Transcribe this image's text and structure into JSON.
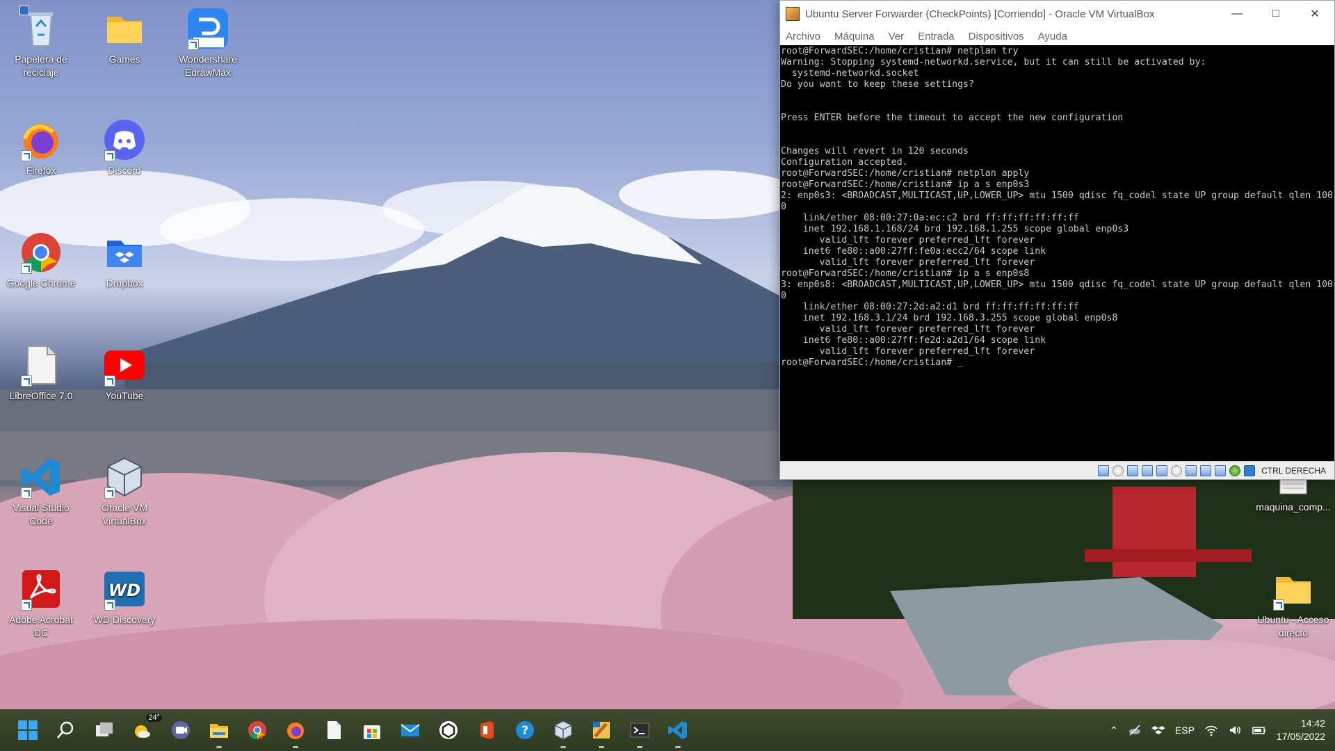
{
  "desktop": {
    "icons": [
      {
        "label": "Papelera de reciclaje",
        "icon": "recycle-bin-icon"
      },
      {
        "label": "Games",
        "icon": "folder-icon"
      },
      {
        "label": "Wondershare EdrawMax",
        "icon": "edrawmax-icon"
      },
      {
        "label": "Firefox",
        "icon": "firefox-icon"
      },
      {
        "label": "Discord",
        "icon": "discord-icon"
      },
      {
        "label": "Google Chrome",
        "icon": "chrome-icon"
      },
      {
        "label": "Dropbox",
        "icon": "dropbox-icon"
      },
      {
        "label": "LibreOffice 7.0",
        "icon": "libreoffice-icon"
      },
      {
        "label": "YouTube",
        "icon": "youtube-icon"
      },
      {
        "label": "Visual Studio Code",
        "icon": "vscode-icon"
      },
      {
        "label": "Oracle VM VirtualBox",
        "icon": "virtualbox-icon"
      },
      {
        "label": "Adobe Acrobat DC",
        "icon": "acrobat-icon"
      },
      {
        "label": "WD Discovery",
        "icon": "wd-discovery-icon"
      },
      {
        "label": "maquina_comp...",
        "icon": "document-icon"
      },
      {
        "label": "Ubuntu - Acceso directo",
        "icon": "folder-icon"
      }
    ]
  },
  "vbox": {
    "title": "Ubuntu Server Forwarder (CheckPoints) [Corriendo] - Oracle VM VirtualBox",
    "menu": [
      "Archivo",
      "Máquina",
      "Ver",
      "Entrada",
      "Dispositivos",
      "Ayuda"
    ],
    "host_key": "CTRL DERECHA",
    "terminal_lines": [
      "root@ForwardSEC:/home/cristian# netplan try",
      "Warning: Stopping systemd-networkd.service, but it can still be activated by:",
      "  systemd-networkd.socket",
      "Do you want to keep these settings?",
      "",
      "",
      "Press ENTER before the timeout to accept the new configuration",
      "",
      "",
      "Changes will revert in 120 seconds",
      "Configuration accepted.",
      "root@ForwardSEC:/home/cristian# netplan apply",
      "root@ForwardSEC:/home/cristian# ip a s enp0s3",
      "2: enp0s3: <BROADCAST,MULTICAST,UP,LOWER_UP> mtu 1500 qdisc fq_codel state UP group default qlen 100",
      "0",
      "    link/ether 08:00:27:0a:ec:c2 brd ff:ff:ff:ff:ff:ff",
      "    inet 192.168.1.168/24 brd 192.168.1.255 scope global enp0s3",
      "       valid_lft forever preferred_lft forever",
      "    inet6 fe80::a00:27ff:fe0a:ecc2/64 scope link",
      "       valid_lft forever preferred_lft forever",
      "root@ForwardSEC:/home/cristian# ip a s enp0s8",
      "3: enp0s8: <BROADCAST,MULTICAST,UP,LOWER_UP> mtu 1500 qdisc fq_codel state UP group default qlen 100",
      "0",
      "    link/ether 08:00:27:2d:a2:d1 brd ff:ff:ff:ff:ff:ff",
      "    inet 192.168.3.1/24 brd 192.168.3.255 scope global enp0s8",
      "       valid_lft forever preferred_lft forever",
      "    inet6 fe80::a00:27ff:fe2d:a2d1/64 scope link",
      "       valid_lft forever preferred_lft forever",
      "root@ForwardSEC:/home/cristian# _"
    ]
  },
  "taskbar": {
    "weather_temp": "24°",
    "language": "ESP",
    "time": "14:42",
    "date": "17/05/2022"
  }
}
